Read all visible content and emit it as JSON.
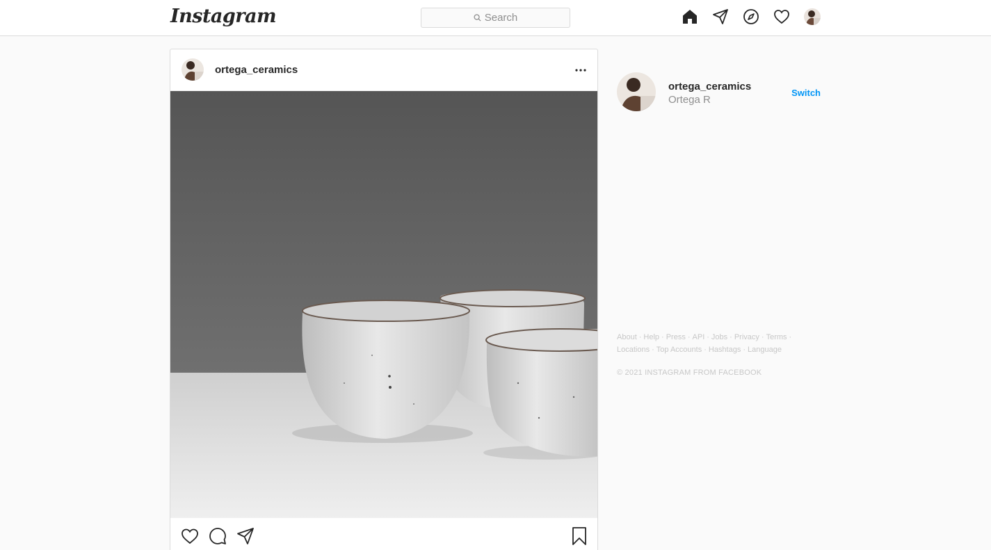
{
  "header": {
    "logo_text": "Instagram",
    "search_placeholder": "Search",
    "nav_icons": [
      "home-icon",
      "direct-icon",
      "explore-icon",
      "activity-icon",
      "profile-avatar"
    ]
  },
  "post": {
    "username": "ortega_ceramics",
    "image_description_icon": "ceramic-bowls-photo",
    "actions": [
      "like-icon",
      "comment-icon",
      "share-icon",
      "save-icon"
    ]
  },
  "sidebar": {
    "username": "ortega_ceramics",
    "full_name": "Ortega R",
    "switch_label": "Switch"
  },
  "footer": {
    "links_row1": [
      "About",
      "Help",
      "Press",
      "API",
      "Jobs",
      "Privacy",
      "Terms"
    ],
    "links_row2": [
      "Locations",
      "Top Accounts",
      "Hashtags",
      "Language"
    ],
    "copyright": "© 2021 INSTAGRAM FROM FACEBOOK"
  },
  "colors": {
    "accent": "#0095f6",
    "border": "#dbdbdb",
    "muted": "#8e8e8e"
  }
}
